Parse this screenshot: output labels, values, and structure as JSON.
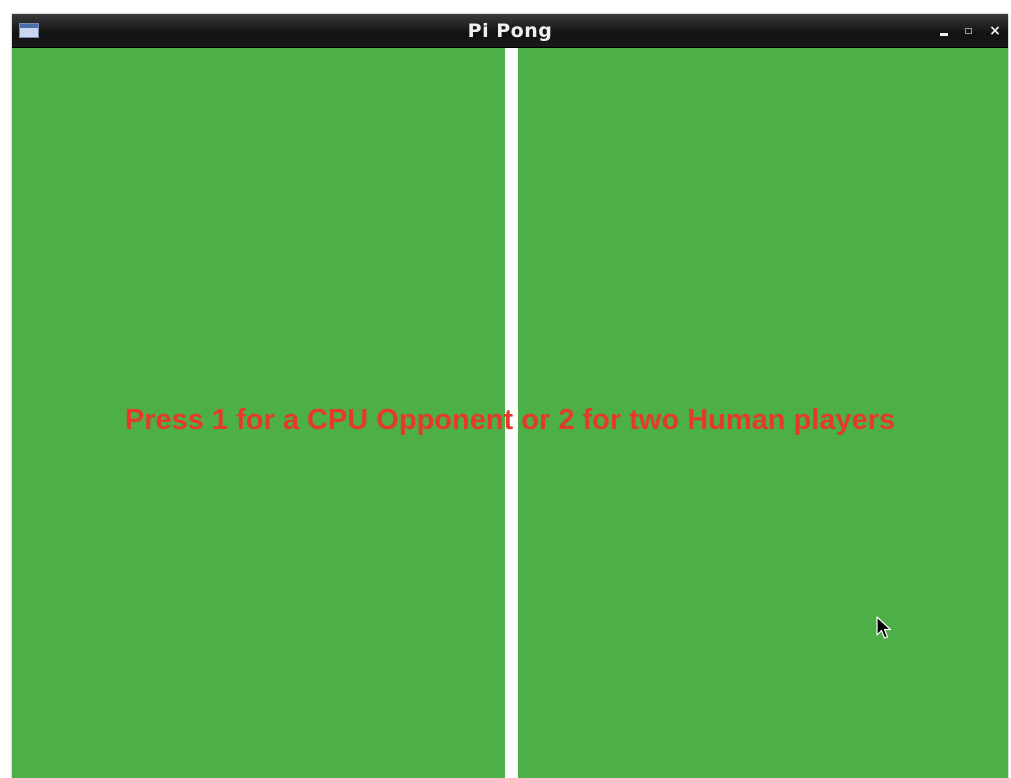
{
  "window": {
    "title": "Pi Pong",
    "close_glyph": "×"
  },
  "game": {
    "prompt": "Press 1 for a CPU Opponent or 2 for two Human players"
  },
  "icons": {
    "window_icon": "window-icon",
    "minimize": "minimize-icon",
    "maximize": "maximize-icon",
    "close": "close-icon",
    "cursor": "mouse-cursor-icon"
  },
  "colors": {
    "field": "#4caf47",
    "net": "#ffffff",
    "prompt": "#e53a2b",
    "titlebar": "#111111"
  }
}
